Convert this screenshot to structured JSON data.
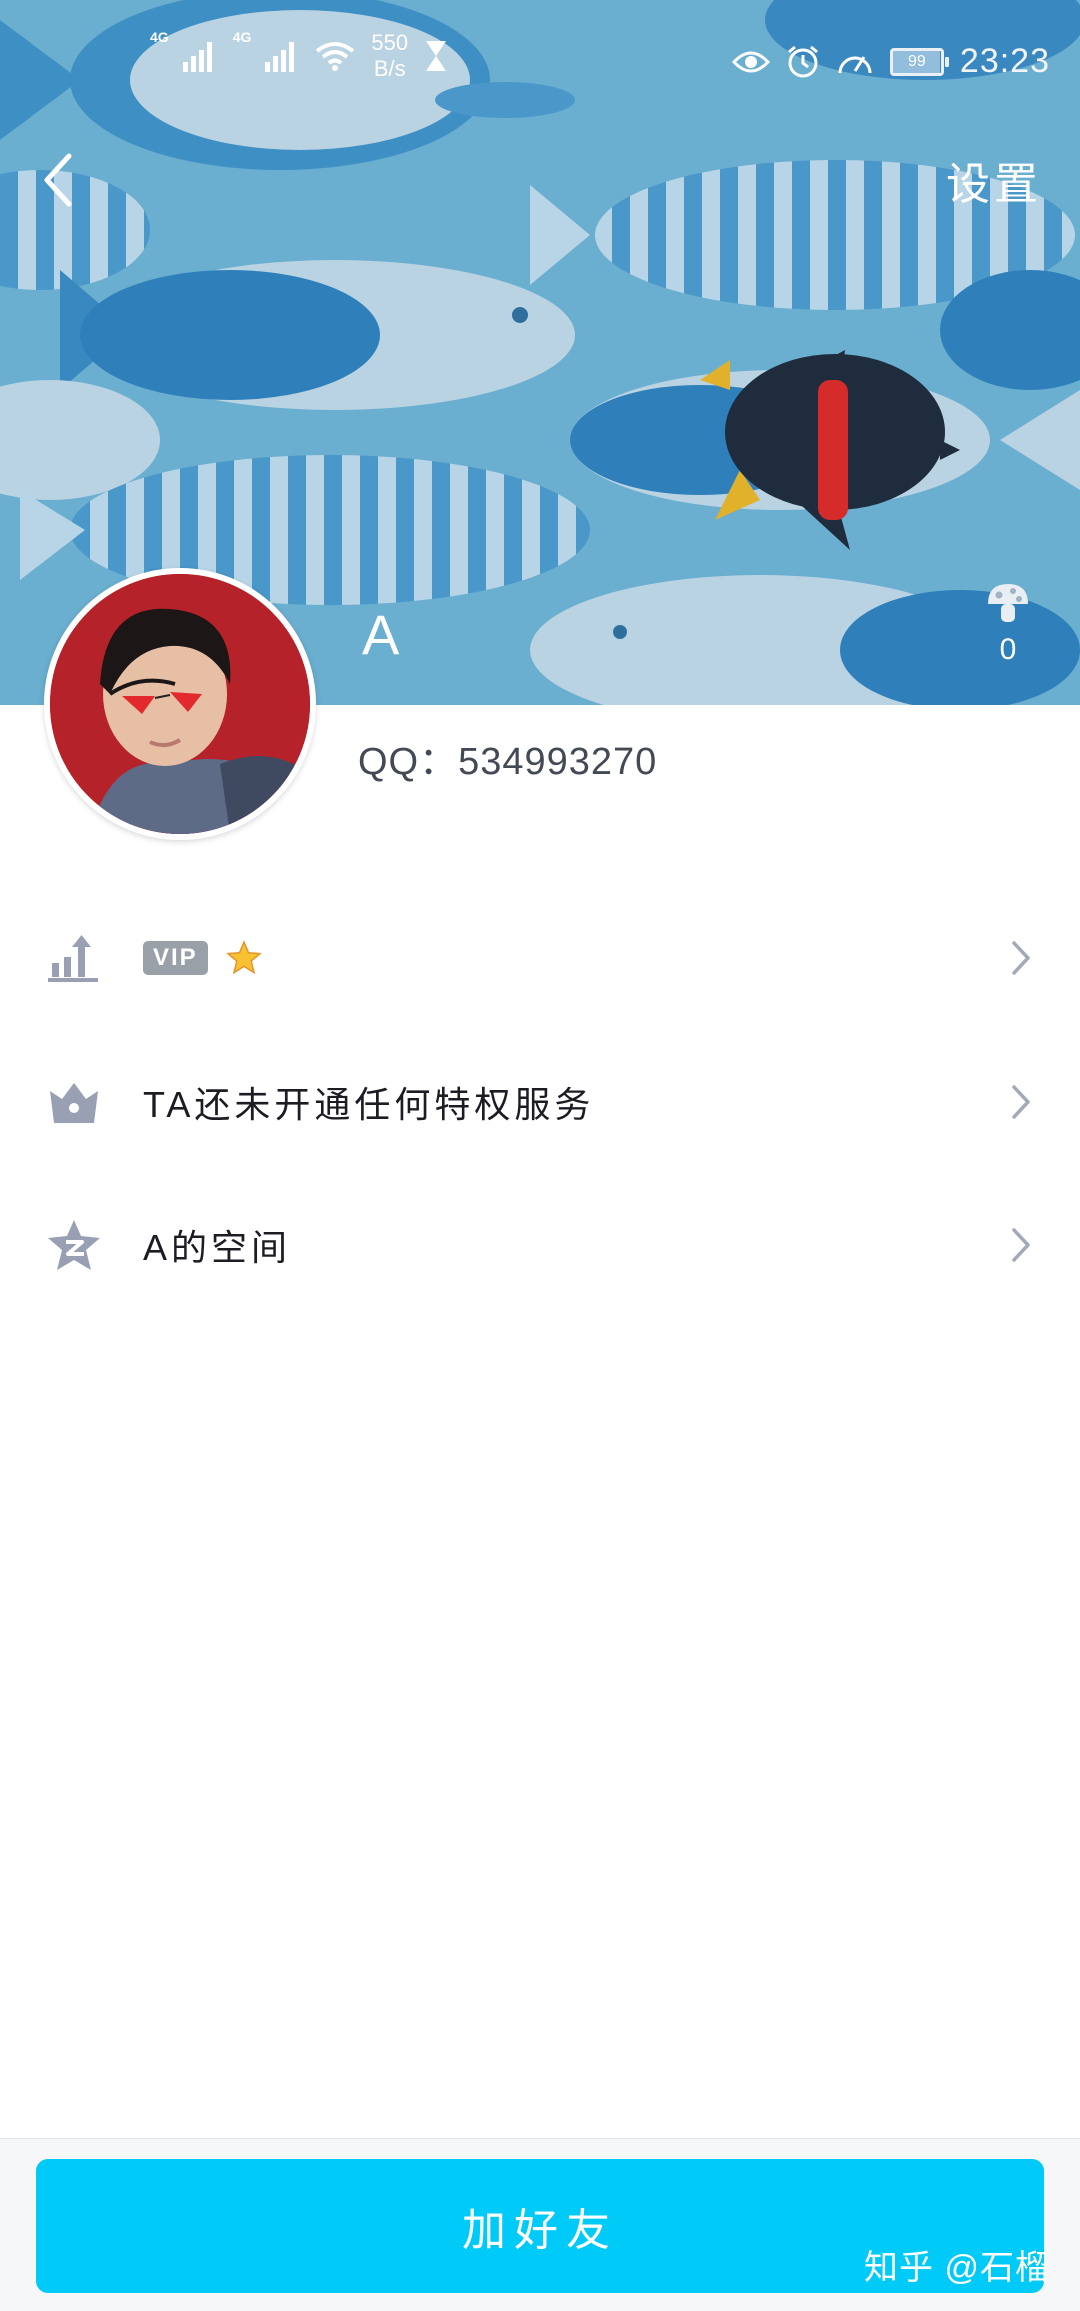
{
  "status_bar": {
    "network_1": "4G",
    "network_2": "4G",
    "speed_value": "550",
    "speed_unit": "B/s",
    "battery": "99",
    "time": "23:23",
    "icons": [
      "signal-icon",
      "wifi-icon",
      "hourglass-icon",
      "eye-icon",
      "alarm-icon",
      "speedometer-icon",
      "battery-icon"
    ]
  },
  "header": {
    "settings_label": "设置",
    "nickname": "A",
    "likes_count": "0"
  },
  "profile": {
    "qq_line": "QQ：534993270"
  },
  "rows": [
    {
      "icon": "level-up-icon",
      "badge": "VIP",
      "extra_icon": "star-icon"
    },
    {
      "icon": "crown-icon",
      "label": "TA还未开通任何特权服务"
    },
    {
      "icon": "qzone-star-icon",
      "label": "A的空间"
    }
  ],
  "footer": {
    "add_friend_label": "加好友",
    "watermark": "知乎 @石榴"
  },
  "colors": {
    "header_bg": "#6aaed0",
    "accent_button": "#00caf7",
    "icon_gray": "#9aa0b4",
    "vip_badge": "#9aa0a8",
    "chevron": "#a3a9b8"
  }
}
